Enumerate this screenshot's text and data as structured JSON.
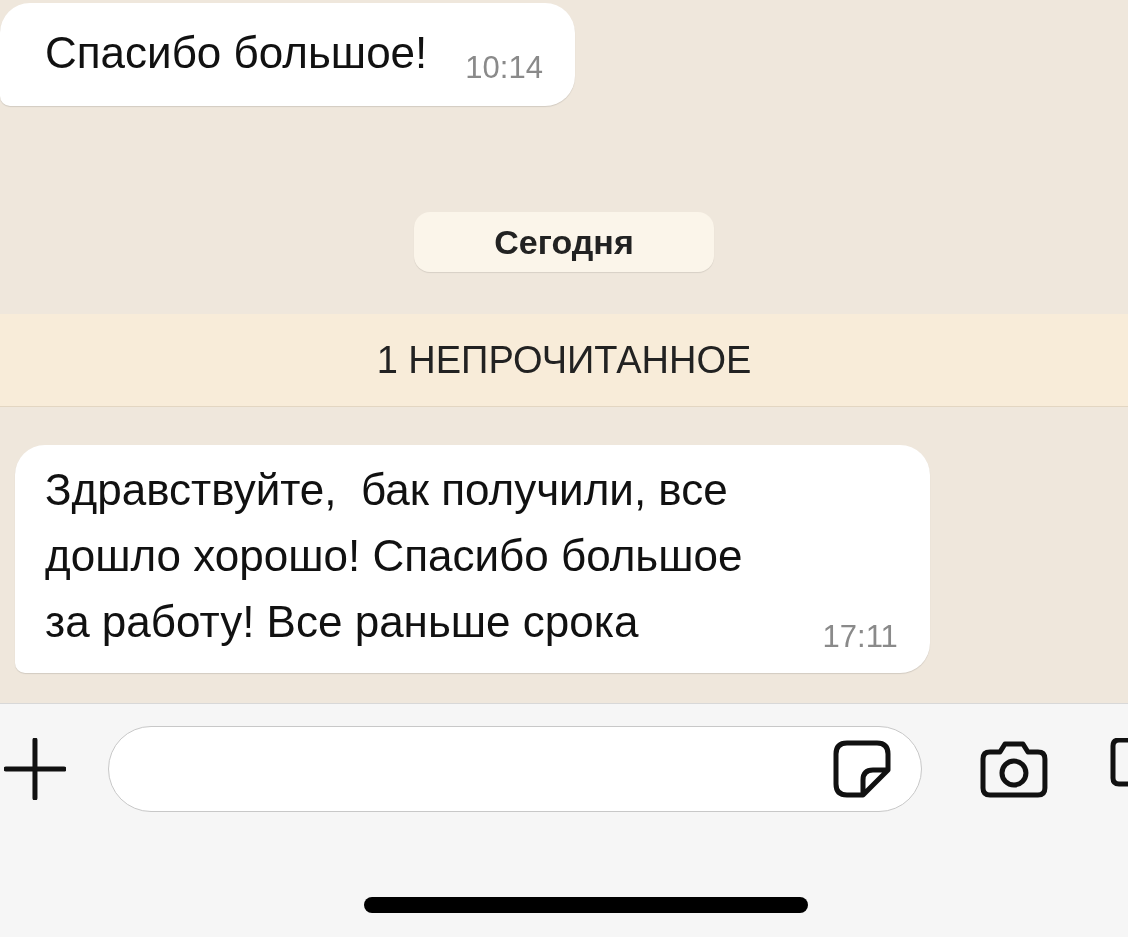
{
  "chat": [
    {
      "kind": "message",
      "text": "Спасибо большое!",
      "time": "10:14"
    },
    {
      "kind": "date",
      "text": "Сегодня"
    },
    {
      "kind": "unread",
      "text": "1 НЕПРОЧИТАННОЕ"
    },
    {
      "kind": "message",
      "text": "Здравствуйте,  бак получили, все\nдошло хорошо! Спасибо большое\nза работу! Все раньше срока",
      "time": "17:11"
    }
  ]
}
